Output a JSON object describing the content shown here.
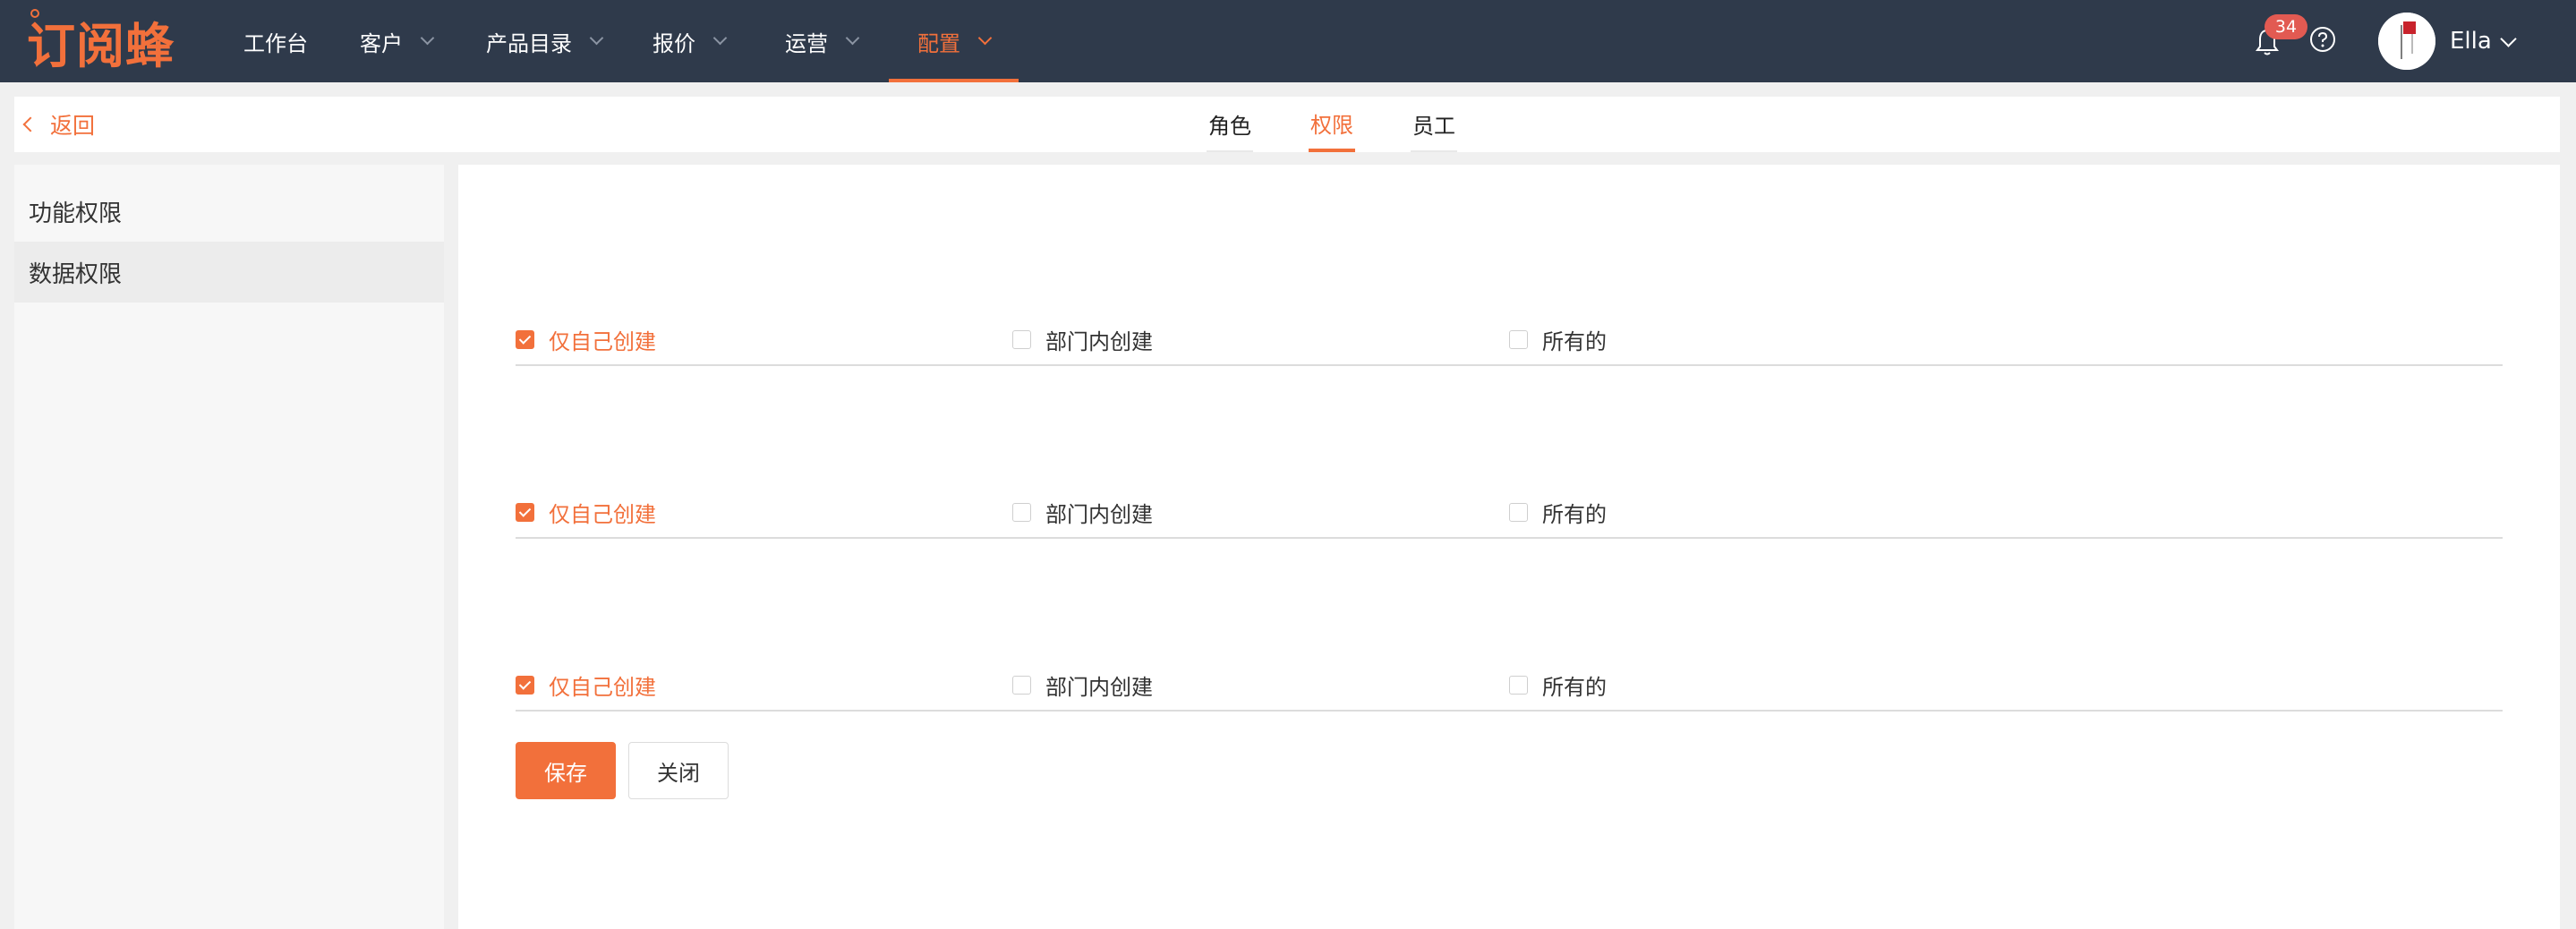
{
  "brand": {
    "logo_text": "订阅蜂",
    "accent": "#f2703b",
    "topbar_bg": "#2f3a4b"
  },
  "nav": {
    "items": [
      {
        "label": "工作台",
        "has_dropdown": false,
        "active": false
      },
      {
        "label": "客户",
        "has_dropdown": true,
        "active": false
      },
      {
        "label": "产品目录",
        "has_dropdown": true,
        "active": false
      },
      {
        "label": "报价",
        "has_dropdown": true,
        "active": false
      },
      {
        "label": "运营",
        "has_dropdown": true,
        "active": false
      },
      {
        "label": "配置",
        "has_dropdown": true,
        "active": true
      }
    ]
  },
  "header_right": {
    "notification_count": "34",
    "bell_icon": "bell-icon",
    "help_icon": "question-circle-icon",
    "user_name": "Ella"
  },
  "subheader": {
    "back_label": "返回",
    "tabs": [
      {
        "label": "角色",
        "active": false
      },
      {
        "label": "权限",
        "active": true
      },
      {
        "label": "员工",
        "active": false
      }
    ]
  },
  "sidemenu": {
    "items": [
      {
        "label": "功能权限",
        "selected": false
      },
      {
        "label": "数据权限",
        "selected": true
      }
    ]
  },
  "permissions": {
    "rows": [
      {
        "options": [
          {
            "label": "仅自己创建",
            "checked": true
          },
          {
            "label": "部门内创建",
            "checked": false
          },
          {
            "label": "所有的",
            "checked": false
          }
        ]
      },
      {
        "options": [
          {
            "label": "仅自己创建",
            "checked": true
          },
          {
            "label": "部门内创建",
            "checked": false
          },
          {
            "label": "所有的",
            "checked": false
          }
        ]
      },
      {
        "options": [
          {
            "label": "仅自己创建",
            "checked": true
          },
          {
            "label": "部门内创建",
            "checked": false
          },
          {
            "label": "所有的",
            "checked": false
          }
        ]
      }
    ]
  },
  "actions": {
    "save_label": "保存",
    "close_label": "关闭"
  }
}
